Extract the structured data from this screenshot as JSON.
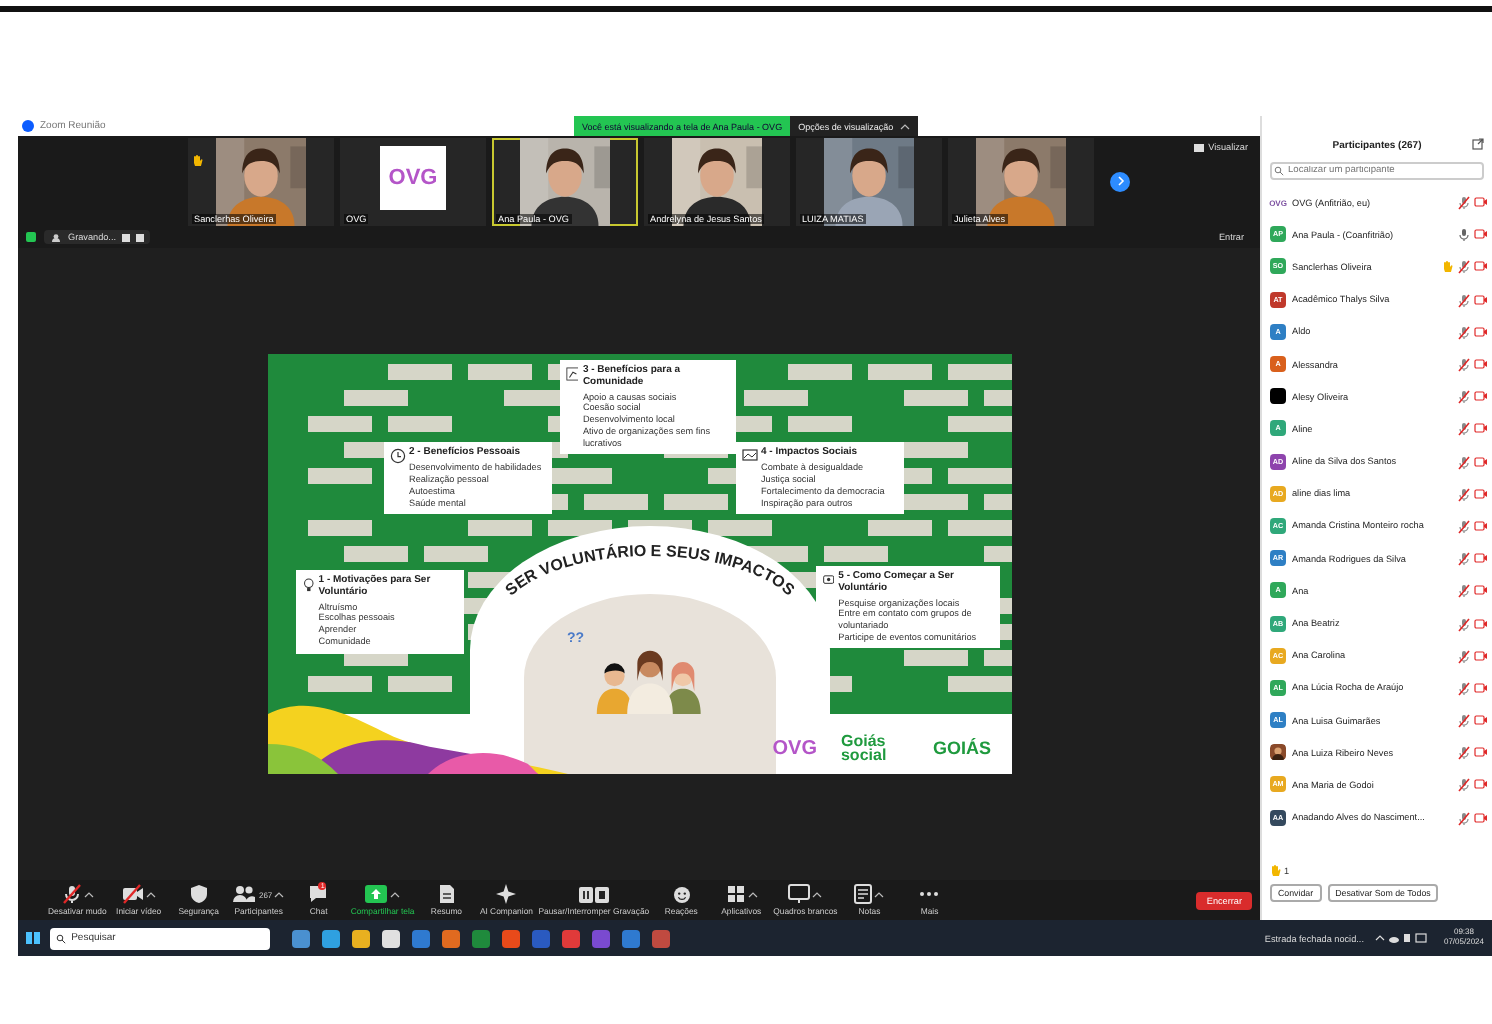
{
  "window": {
    "title": "Zoom Reunião"
  },
  "banner": {
    "text": "Você está visualizando a tela de Ana Paula - OVG",
    "options": "Opções de visualização"
  },
  "video_strip": {
    "tiles": [
      {
        "name": "Sanclerhas Oliveira",
        "kind": "video",
        "active": false,
        "hand_raised": true
      },
      {
        "name": "OVG",
        "kind": "logo",
        "active": false,
        "hand_raised": false,
        "logo": "OVG"
      },
      {
        "name": "Ana Paula - OVG",
        "kind": "video",
        "active": true,
        "hand_raised": false
      },
      {
        "name": "Andrelyna de Jesus Santos",
        "kind": "video",
        "active": false,
        "hand_raised": false
      },
      {
        "name": "LUIZA MATIAS",
        "kind": "video",
        "active": false,
        "hand_raised": false
      },
      {
        "name": "Julieta Alves",
        "kind": "video",
        "active": false,
        "hand_raised": false
      }
    ],
    "view_label": "Visualizar"
  },
  "recording": {
    "status": "Gravando...",
    "right_label": "Entrar"
  },
  "slide": {
    "title": "SER VOLUNTÁRIO E SEUS IMPACTOS",
    "question": "??",
    "sections": [
      {
        "heading": "1 - Motivações para Ser Voluntário",
        "items": [
          "Altruísmo",
          "Escolhas pessoais",
          "Aprender",
          "Comunidade"
        ]
      },
      {
        "heading": "2 - Benefícios Pessoais",
        "items": [
          "Desenvolvimento de habilidades",
          "Realização pessoal",
          "Autoestima",
          "Saúde mental"
        ]
      },
      {
        "heading": "3 - Benefícios para a Comunidade",
        "items": [
          "Apoio a causas sociais",
          "Coesão social",
          "Desenvolvimento local",
          "Ativo de organizações sem fins lucrativos"
        ]
      },
      {
        "heading": "4 - Impactos Sociais",
        "items": [
          "Combate à desigualdade",
          "Justiça social",
          "Fortalecimento da democracia",
          "Inspiração para outros"
        ]
      },
      {
        "heading": "5 - Como Começar a Ser Voluntário",
        "items": [
          "Pesquise organizações locais",
          "Entre em contato com grupos de voluntariado",
          "Participe de eventos comunitários"
        ]
      }
    ],
    "logos": [
      "OVG",
      "Goiás social",
      "GOIÁS"
    ]
  },
  "toolbar": {
    "items": [
      {
        "label": "Desativar mudo",
        "active": false
      },
      {
        "label": "Iniciar vídeo",
        "active": false
      },
      {
        "label": "Segurança",
        "active": false
      },
      {
        "label": "Participantes",
        "active": false,
        "count": "267"
      },
      {
        "label": "Chat",
        "active": false,
        "badge": "1"
      },
      {
        "label": "Compartilhar tela",
        "active": true
      },
      {
        "label": "Resumo",
        "active": false
      },
      {
        "label": "AI Companion",
        "active": false
      },
      {
        "label": "Pausar/Interromper Gravação",
        "active": false
      },
      {
        "label": "Reações",
        "active": false
      },
      {
        "label": "Aplicativos",
        "active": false
      },
      {
        "label": "Quadros brancos",
        "active": false
      },
      {
        "label": "Notas",
        "active": false
      },
      {
        "label": "Mais",
        "active": false
      }
    ],
    "end_button": "Encerrar"
  },
  "participants": {
    "title": "Participantes (267)",
    "search": {
      "placeholder": "Localizar um participante"
    },
    "rows": [
      {
        "name": "OVG (Anfitrião, eu)",
        "kind": "logo",
        "initials": "OVG",
        "color": "#7b4fa0",
        "muted": true,
        "hand_raised": false
      },
      {
        "name": "Ana Paula - (Coanfitrião)",
        "kind": "initials",
        "initials": "AP",
        "color": "#2fa85a",
        "muted": false,
        "hand_raised": false
      },
      {
        "name": "Sanclerhas Oliveira",
        "kind": "initials",
        "initials": "SO",
        "color": "#2fa85a",
        "muted": true,
        "hand_raised": true
      },
      {
        "name": "Acadêmico Thalys Silva",
        "kind": "initials",
        "initials": "AT",
        "color": "#c0392b",
        "muted": true,
        "hand_raised": false
      },
      {
        "name": "Aldo",
        "kind": "initials",
        "initials": "A",
        "color": "#2e7fc4",
        "muted": true,
        "hand_raised": false
      },
      {
        "name": "Alessandra",
        "kind": "initials",
        "initials": "A",
        "color": "#d9601c",
        "muted": true,
        "hand_raised": false
      },
      {
        "name": "Alesy Oliveira",
        "kind": "blank",
        "color": "#000000",
        "muted": true,
        "hand_raised": false
      },
      {
        "name": "Aline",
        "kind": "initials",
        "initials": "A",
        "color": "#2fa87a",
        "muted": true,
        "hand_raised": false
      },
      {
        "name": "Aline da Silva dos Santos",
        "kind": "initials",
        "initials": "AD",
        "color": "#8e44ad",
        "muted": true,
        "hand_raised": false
      },
      {
        "name": "aline dias lima",
        "kind": "initials",
        "initials": "AD",
        "color": "#e8a920",
        "muted": true,
        "hand_raised": false
      },
      {
        "name": "Amanda Cristina Monteiro rocha",
        "kind": "initials",
        "initials": "AC",
        "color": "#2fa87a",
        "muted": true,
        "hand_raised": false
      },
      {
        "name": "Amanda Rodrigues da Silva",
        "kind": "initials",
        "initials": "AR",
        "color": "#2e7fc4",
        "muted": true,
        "hand_raised": false
      },
      {
        "name": "Ana",
        "kind": "initials",
        "initials": "A",
        "color": "#2fa85a",
        "muted": true,
        "hand_raised": false
      },
      {
        "name": "Ana Beatriz",
        "kind": "initials",
        "initials": "AB",
        "color": "#2fa87a",
        "muted": true,
        "hand_raised": false
      },
      {
        "name": "Ana Carolina",
        "kind": "initials",
        "initials": "AC",
        "color": "#e8a920",
        "muted": true,
        "hand_raised": false
      },
      {
        "name": "Ana Lúcia Rocha de Araújo",
        "kind": "initials",
        "initials": "AL",
        "color": "#2fa85a",
        "muted": true,
        "hand_raised": false
      },
      {
        "name": "Ana Luisa Guimarães",
        "kind": "initials",
        "initials": "AL",
        "color": "#2e7fc4",
        "muted": true,
        "hand_raised": false
      },
      {
        "name": "Ana Luiza Ribeiro Neves",
        "color": "#8a4a2a",
        "muted": true,
        "hand_raised": false
      },
      {
        "name": "Ana Maria de Godoi",
        "kind": "initials",
        "initials": "AM",
        "color": "#e8a920",
        "muted": true,
        "hand_raised": false
      },
      {
        "name": "Anadando Alves do Nasciment...",
        "kind": "initials",
        "initials": "AA",
        "color": "#34495e",
        "muted": true,
        "hand_raised": false
      }
    ],
    "raised_count": "1",
    "buttons": [
      "Convidar",
      "Desativar Som de Todos"
    ]
  },
  "taskbar": {
    "search": "Pesquisar",
    "weather": "Estrada fechada nocid...",
    "time": "09:38",
    "date": "07/05/2024"
  }
}
